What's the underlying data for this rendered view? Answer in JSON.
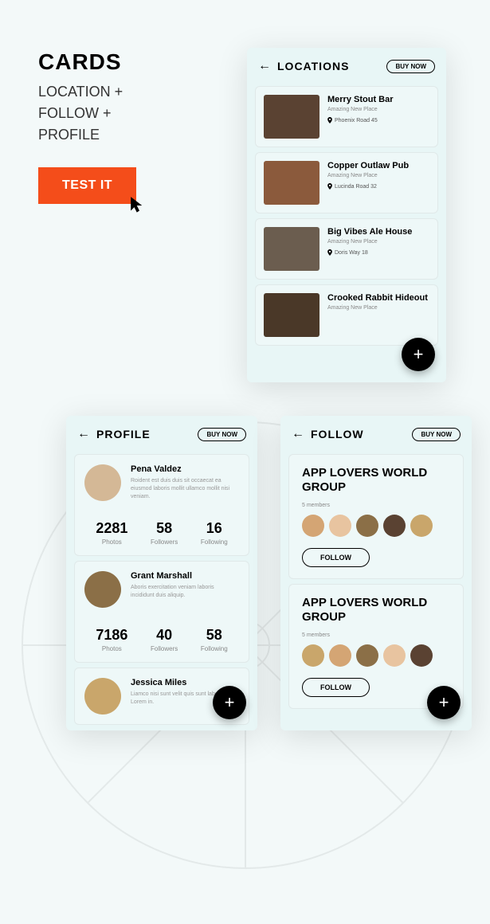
{
  "header": {
    "title": "CARDS",
    "sub1": "LOCATION +",
    "sub2": "FOLLOW +",
    "sub3": "PROFILE",
    "test": "TEST IT"
  },
  "buy": "BUY NOW",
  "locations": {
    "title": "LOCATIONS",
    "items": [
      {
        "name": "Merry Stout Bar",
        "sub": "Amazing New Place",
        "addr": "Phoenix Road 45",
        "color": "#5a4232"
      },
      {
        "name": "Copper Outlaw Pub",
        "sub": "Amazing New Place",
        "addr": "Lucinda Road 32",
        "color": "#8b5a3c"
      },
      {
        "name": "Big Vibes Ale House",
        "sub": "Amazing New Place",
        "addr": "Doris Way 18",
        "color": "#6b5d4f"
      },
      {
        "name": "Crooked Rabbit Hideout",
        "sub": "Amazing New Place",
        "addr": "",
        "color": "#4a3828"
      }
    ]
  },
  "profile": {
    "title": "PROFILE",
    "items": [
      {
        "name": "Pena Valdez",
        "bio": "Roident est duis duis sit occaecat ea eiusmod laboris mollit ullamco mollit nisi veniam.",
        "photos": "2281",
        "followers": "58",
        "following": "16",
        "color": "#d4b896"
      },
      {
        "name": "Grant Marshall",
        "bio": "Aboris exercitation veniam laboris incididunt duis aliquip.",
        "photos": "7186",
        "followers": "40",
        "following": "58",
        "color": "#8b6f47"
      },
      {
        "name": "Jessica Miles",
        "bio": "Liamco nisi sunt velit quis sunt laboris esse Lorem in.",
        "photos": "",
        "followers": "",
        "following": "",
        "color": "#c9a66b"
      }
    ],
    "labels": {
      "photos": "Photos",
      "followers": "Followers",
      "following": "Following"
    }
  },
  "follow": {
    "title": "FOLLOW",
    "btn": "FOLLOW",
    "groups": [
      {
        "name": "APP LOVERS WORLD GROUP",
        "members": "5 members",
        "avatars": [
          "#d4a574",
          "#e8c4a0",
          "#8b6f47",
          "#5a4232",
          "#c9a66b"
        ]
      },
      {
        "name": "APP LOVERS WORLD GROUP",
        "members": "5 members",
        "avatars": [
          "#c9a66b",
          "#d4a574",
          "#8b6f47",
          "#e8c4a0",
          "#5a4232"
        ]
      }
    ]
  }
}
